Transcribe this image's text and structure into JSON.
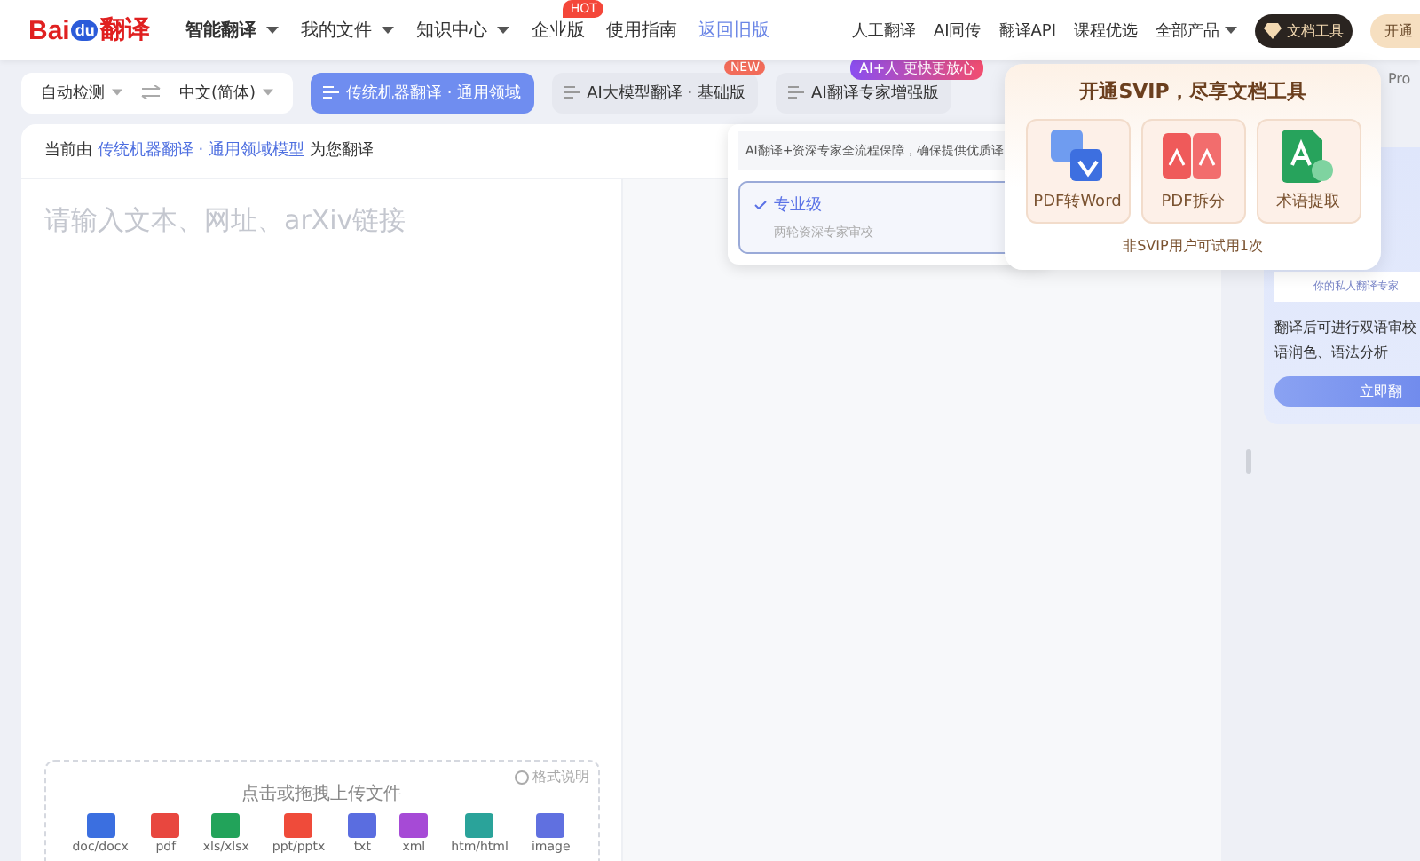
{
  "logo": {
    "brand": "Bai",
    "paw": "du",
    "product": "翻译"
  },
  "nav": [
    {
      "label": "智能翻译",
      "caret": true,
      "selected": true,
      "kind": "menu"
    },
    {
      "label": "我的文件",
      "caret": true,
      "selected": false,
      "kind": "menu"
    },
    {
      "label": "知识中心",
      "caret": true,
      "selected": false,
      "kind": "menu"
    },
    {
      "label": "企业版",
      "caret": false,
      "selected": false,
      "kind": "menu",
      "badge": "HOT"
    },
    {
      "label": "使用指南",
      "caret": false,
      "selected": false,
      "kind": "menu"
    },
    {
      "label": "返回旧版",
      "caret": false,
      "selected": false,
      "kind": "link"
    }
  ],
  "right_nav": [
    {
      "label": "人工翻译",
      "caret": false
    },
    {
      "label": "AI同传",
      "caret": false
    },
    {
      "label": "翻译API",
      "caret": false
    },
    {
      "label": "课程优选",
      "caret": false
    },
    {
      "label": "全部产品",
      "caret": true
    }
  ],
  "doc_tools_button": "文档工具",
  "open_button": "开通",
  "lang_bar": {
    "source": "自动检测",
    "target": "中文(简体)"
  },
  "modes": [
    {
      "label": "传统机器翻译 · 通用领域",
      "selected": true
    },
    {
      "label": "AI大模型翻译 · 基础版",
      "selected": false,
      "badge": "NEW"
    },
    {
      "label": "AI翻译专家增强版",
      "selected": false,
      "badge": "AI+人 更快更放心"
    }
  ],
  "notice": {
    "prefix": "当前由",
    "link": "传统机器翻译 · 通用领域模型",
    "suffix": "为您翻译"
  },
  "input": {
    "placeholder": "请输入文本、网址、arXiv链接"
  },
  "upload": {
    "title": "点击或拖拽上传文件",
    "help": "格式说明",
    "formats": [
      {
        "label": "doc/docx",
        "color": "#3b6fe0"
      },
      {
        "label": "pdf",
        "color": "#e8473f"
      },
      {
        "label": "xls/xlsx",
        "color": "#22a35a"
      },
      {
        "label": "ppt/pptx",
        "color": "#ef4b3a"
      },
      {
        "label": "txt",
        "color": "#5a6de0"
      },
      {
        "label": "xml",
        "color": "#a64ad6"
      },
      {
        "label": "htm/html",
        "color": "#2aa39a"
      },
      {
        "label": "image",
        "color": "#6070e0"
      }
    ]
  },
  "dropdown": {
    "description": "AI翻译+资深专家全流程保障，确保提供优质译",
    "options": [
      {
        "title": "专业级",
        "subtitle": "两轮资深专家审校",
        "selected": true
      }
    ]
  },
  "popup": {
    "title": "开通SVIP，尽享文档工具",
    "tools": [
      {
        "label": "PDF转Word",
        "kind": "pdf-word"
      },
      {
        "label": "PDF拆分",
        "kind": "pdf-split"
      },
      {
        "label": "术语提取",
        "kind": "term"
      }
    ],
    "footnote": "非SVIP用户可试用1次"
  },
  "sidebar": {
    "heading": "Pro",
    "tagline": "你的私人翻译专家",
    "description": [
      "翻译后可进行双语审校",
      "语润色、语法分析"
    ],
    "button": "立即翻"
  }
}
